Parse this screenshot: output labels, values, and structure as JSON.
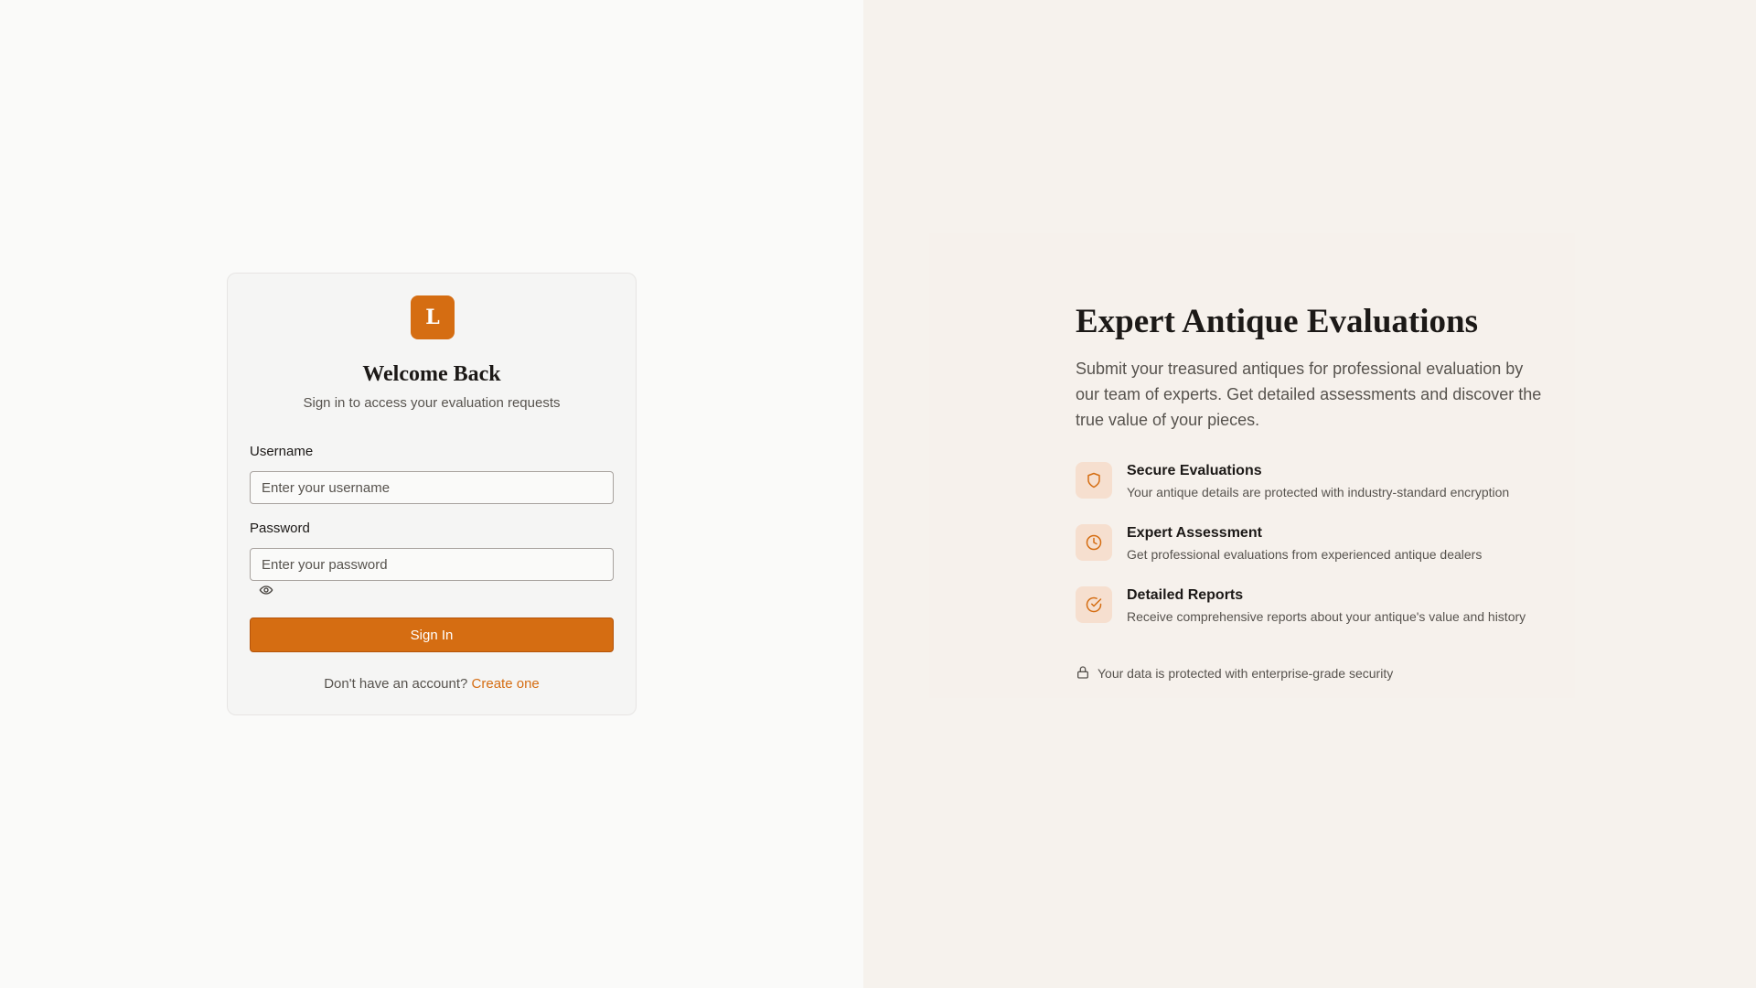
{
  "login": {
    "logo_letter": "L",
    "title": "Welcome Back",
    "subtitle": "Sign in to access your evaluation requests",
    "username_label": "Username",
    "username_placeholder": "Enter your username",
    "password_label": "Password",
    "password_placeholder": "Enter your password",
    "signin_label": "Sign In",
    "signup_prompt": "Don't have an account?",
    "signup_link": "Create one"
  },
  "hero": {
    "title": "Expert Antique Evaluations",
    "description": "Submit your treasured antiques for professional evaluation by our team of experts. Get detailed assessments and discover the true value of your pieces.",
    "features": [
      {
        "icon": "shield-icon",
        "title": "Secure Evaluations",
        "desc": "Your antique details are protected with industry-standard encryption"
      },
      {
        "icon": "clock-icon",
        "title": "Expert Assessment",
        "desc": "Get professional evaluations from experienced antique dealers"
      },
      {
        "icon": "check-circle-icon",
        "title": "Detailed Reports",
        "desc": "Receive comprehensive reports about your antique's value and history"
      }
    ],
    "security_note": "Your data is protected with enterprise-grade security"
  },
  "colors": {
    "accent": "#d56d12",
    "icon_bg": "#f6dfcf",
    "right_bg": "#f6f2ed"
  }
}
